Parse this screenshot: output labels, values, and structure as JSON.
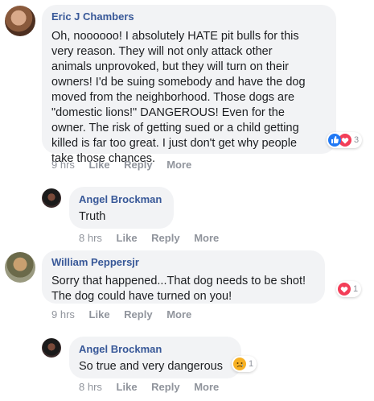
{
  "comments": [
    {
      "author": "Eric J Chambers",
      "lines": [
        "Oh, noooooo! I absolutely HATE pit bulls for this",
        "very reason. They will not only attack other",
        "animals unprovoked, but they will turn on their",
        "owners! I'd be suing somebody and have the dog",
        "moved from the neighborhood. Those dogs are",
        "\"domestic lions!\" DANGEROUS! Even for the",
        "owner. The risk of getting sued or a child getting",
        "killed is far too great. I just don't get why people",
        "take those chances."
      ],
      "time": "9 hrs",
      "like": "Like",
      "reply": "Reply",
      "more": "More",
      "reaction_count": "3",
      "reactions": [
        "like-icon",
        "love-icon"
      ]
    },
    {
      "author": "Angel Brockman",
      "lines": [
        "Truth"
      ],
      "time": "8 hrs",
      "like": "Like",
      "reply": "Reply",
      "more": "More"
    },
    {
      "author": "William Peppersjr",
      "lines": [
        "Sorry that happened...That dog needs to be shot!",
        "The dog could have turned on you!"
      ],
      "time": "9 hrs",
      "like": "Like",
      "reply": "Reply",
      "more": "More",
      "reaction_count": "1",
      "reactions": [
        "love-icon"
      ]
    },
    {
      "author": "Angel Brockman",
      "lines": [
        "So true and very dangerous"
      ],
      "time": "8 hrs",
      "like": "Like",
      "reply": "Reply",
      "more": "More",
      "reaction_count": "1",
      "reactions": [
        "sad-icon"
      ]
    }
  ],
  "colors": {
    "author": "#385898",
    "bubble": "#f2f3f5",
    "meta": "#90949c",
    "like_blue": "#2078f4",
    "love_red": "#f33e58",
    "sad_yellow": "#f7b125"
  }
}
